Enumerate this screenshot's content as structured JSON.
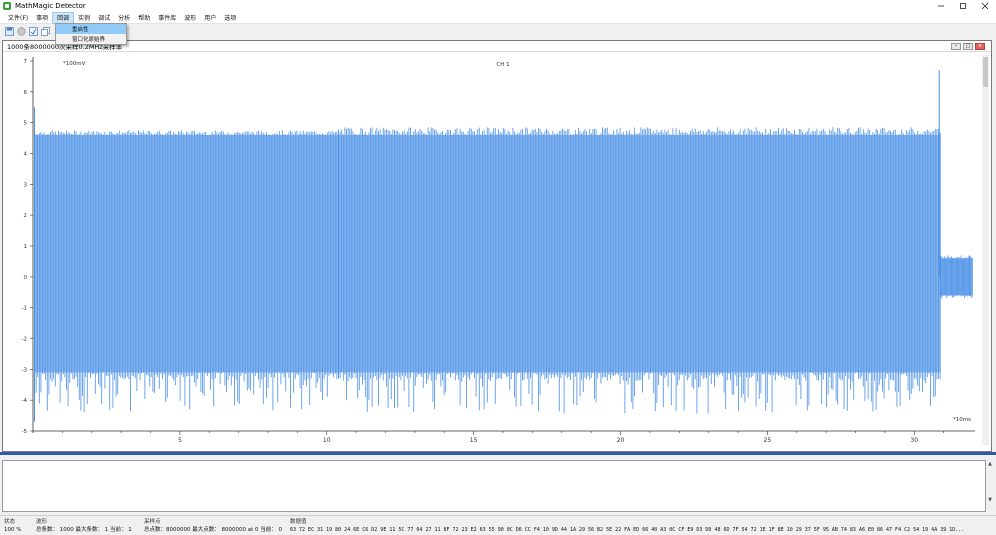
{
  "window": {
    "title": "MathMagic Detector"
  },
  "menu": {
    "items": [
      "文件(F)",
      "事项",
      "回调",
      "实例",
      "调试",
      "分析",
      "帮助",
      "事件库",
      "波形",
      "用户",
      "选项"
    ],
    "active_index": 2
  },
  "dropdown": {
    "items": [
      "重启性",
      "窗口化原始界"
    ]
  },
  "plot_window": {
    "title": "1000条8000000次采样0.2MHz采样率",
    "controls": [
      "–",
      "□",
      "×"
    ]
  },
  "chart_data": {
    "type": "line",
    "title": "CH 1",
    "ylabel": "*100mV",
    "xlabel": "*10ms",
    "xlim": [
      0,
      32
    ],
    "ylim": [
      -5,
      7
    ],
    "x_ticks": [
      5,
      10,
      15,
      20,
      25,
      30
    ],
    "y_ticks": [
      7,
      6,
      5,
      4,
      3,
      2,
      1,
      0,
      -1,
      -2,
      -3,
      -4,
      -5
    ],
    "grid": false,
    "series": [
      {
        "color": "#4a8fe6",
        "segments": [
          {
            "x_start": 0.05,
            "x_end": 10.4,
            "high": 4.6,
            "low": -3.1,
            "peak_high": 4.75,
            "peak_low": -4.4
          },
          {
            "x_start": 10.4,
            "x_end": 30.9,
            "high": 4.6,
            "low": -3.1,
            "peak_high": 4.85,
            "peak_low": -4.45
          },
          {
            "x_start": 30.9,
            "x_end": 32.0,
            "high": 0.6,
            "low": -0.6,
            "peak_high": 0.7,
            "peak_low": -0.7
          }
        ],
        "spikes": [
          {
            "x": 30.85,
            "y": 6.7
          },
          {
            "x": 0.05,
            "y": 5.5
          },
          {
            "x": 0.05,
            "y": -4.7
          }
        ]
      }
    ]
  },
  "status": {
    "state_label": "状态",
    "state_value": "100 %",
    "wave_label": "波形",
    "wave_value": "总条数： 1000 最大条数： 1 当前： 1",
    "sample_label": "采样点",
    "sample_value": "总点数：8000000 最大点数： 8000000 at 0 当前： 0",
    "data_label": "数据值",
    "data_value": "63 72 EC 31 19 80 24 6E C6 D2 9E 11 5C 77 04 27 11 8F 72 23 E2 63 55 90 0C D6 CC F4 10 9D 44 1A 29 56 B2 5E 22 FA ED 66 40 A3 0C CF E9 D3 D0 48 6D 7F 54 72 1E 1F 8E 10 29 37 5F 95 AB 74 83 A6 E0 86 47 F4 C2 54 19 4A 39 1D..."
  }
}
